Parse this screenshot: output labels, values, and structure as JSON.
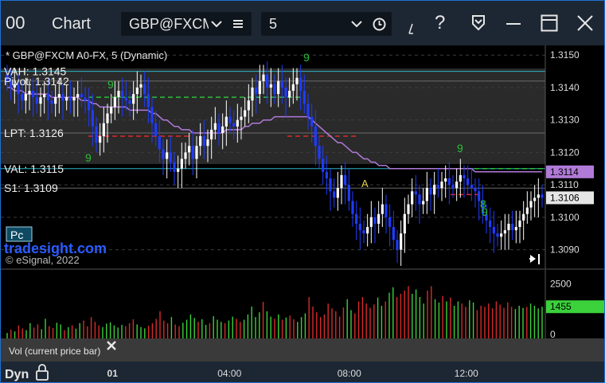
{
  "window": {
    "icon_text": "00",
    "title": "Chart",
    "symbol": "GBP@FXCM",
    "interval": "5",
    "help_glyph": "?",
    "accent_color": "#1f6fd1"
  },
  "chart_data": {
    "type": "candlestick",
    "title": "* GBP@FXCM A0-FX, 5 (Dynamic)",
    "watermark": "tradesight.com",
    "copyright": "© eSignal, 2022",
    "ylim": [
      1.3084,
      1.3153
    ],
    "y_ticks": [
      "1.3150",
      "1.3140",
      "1.3130",
      "1.3120",
      "1.3110",
      "1.3100",
      "1.3090"
    ],
    "x_ticks": [
      "01",
      "04:00",
      "08:00",
      "12:00"
    ],
    "last_price": "1.3106",
    "ma_value": "1.3114",
    "levels": [
      {
        "label": "VAH: 1.3145",
        "value": 1.3145,
        "color": "#2ab6c9"
      },
      {
        "label": "Pivot: 1.3142",
        "value": 1.3142,
        "color": "#6b6b6b"
      },
      {
        "label": "LPT: 1.3126",
        "value": 1.3126,
        "color": "#6b6b6b"
      },
      {
        "label": "VAL: 1.3115",
        "value": 1.3115,
        "color": "#2ab6c9"
      },
      {
        "label": "S1: 1.3109",
        "value": 1.3109,
        "color": "#6b6b6b"
      }
    ],
    "annotation_A": "A",
    "pc_label": "Pc",
    "candle_color_up": "#ffffff",
    "candle_color_down": "#1f3cff",
    "ma_color": "#b07ad9",
    "closes": [
      1.3142,
      1.314,
      1.3141,
      1.3138,
      1.3136,
      1.3138,
      1.3139,
      1.3137,
      1.3135,
      1.3137,
      1.3138,
      1.3136,
      1.3135,
      1.3137,
      1.3138,
      1.3136,
      1.3137,
      1.3136,
      1.3137,
      1.3138,
      1.3137,
      1.3136,
      1.3133,
      1.3128,
      1.3123,
      1.3125,
      1.3129,
      1.3132,
      1.3134,
      1.3137,
      1.3139,
      1.3137,
      1.3136,
      1.3135,
      1.3138,
      1.314,
      1.3141,
      1.3138,
      1.3134,
      1.3129,
      1.3125,
      1.3121,
      1.3118,
      1.312,
      1.3117,
      1.3114,
      1.3115,
      1.3118,
      1.312,
      1.3122,
      1.3118,
      1.3122,
      1.3125,
      1.3122,
      1.3124,
      1.3127,
      1.3129,
      1.3126,
      1.3128,
      1.3131,
      1.3129,
      1.3128,
      1.313,
      1.3131,
      1.3133,
      1.3136,
      1.314,
      1.3138,
      1.3142,
      1.3144,
      1.314,
      1.3141,
      1.3138,
      1.3142,
      1.314,
      1.3137,
      1.3139,
      1.3141,
      1.3143,
      1.3139,
      1.3135,
      1.3131,
      1.3128,
      1.3122,
      1.3118,
      1.3114,
      1.3112,
      1.3108,
      1.3106,
      1.3109,
      1.3113,
      1.311,
      1.3105,
      1.3101,
      1.3098,
      1.3096,
      1.3095,
      1.3097,
      1.31,
      1.3098,
      1.3101,
      1.3104,
      1.31,
      1.3097,
      1.3093,
      1.309,
      1.3095,
      1.3101,
      1.3104,
      1.3108,
      1.3107,
      1.3104,
      1.3105,
      1.3109,
      1.3107,
      1.311,
      1.3109,
      1.3111,
      1.3112,
      1.311,
      1.3109,
      1.3111,
      1.3113,
      1.3112,
      1.311,
      1.3109,
      1.3108,
      1.3105,
      1.3101,
      1.3099,
      1.3097,
      1.3095,
      1.3094,
      1.3095,
      1.3096,
      1.3098,
      1.3096,
      1.3097,
      1.3099,
      1.3101,
      1.3103,
      1.3105,
      1.3106,
      1.3107,
      1.3106
    ],
    "ma": [
      1.314,
      1.314,
      1.3139,
      1.3139,
      1.3139,
      1.3138,
      1.3138,
      1.3138,
      1.3138,
      1.3138,
      1.3138,
      1.3138,
      1.3137,
      1.3137,
      1.3137,
      1.3137,
      1.3137,
      1.3137,
      1.3137,
      1.3137,
      1.3136,
      1.3136,
      1.3136,
      1.3135,
      1.3135,
      1.3134,
      1.3134,
      1.3134,
      1.3134,
      1.3134,
      1.3134,
      1.3134,
      1.3134,
      1.3133,
      1.3133,
      1.3133,
      1.3133,
      1.3133,
      1.3133,
      1.3132,
      1.3132,
      1.3131,
      1.313,
      1.313,
      1.3129,
      1.3128,
      1.3128,
      1.3127,
      1.3127,
      1.3127,
      1.3126,
      1.3126,
      1.3126,
      1.3126,
      1.3126,
      1.3126,
      1.3126,
      1.3126,
      1.3126,
      1.3127,
      1.3127,
      1.3127,
      1.3127,
      1.3127,
      1.3128,
      1.3128,
      1.3129,
      1.3129,
      1.3129,
      1.313,
      1.313,
      1.313,
      1.3131,
      1.3131,
      1.3131,
      1.3131,
      1.3131,
      1.3131,
      1.3131,
      1.3131,
      1.3131,
      1.3131,
      1.313,
      1.3129,
      1.3128,
      1.3127,
      1.3126,
      1.3125,
      1.3124,
      1.3123,
      1.3123,
      1.3122,
      1.3121,
      1.312,
      1.312,
      1.3119,
      1.3118,
      1.3118,
      1.3117,
      1.3117,
      1.3116,
      1.3116,
      1.3116,
      1.3115,
      1.3115,
      1.3115,
      1.3115,
      1.3115,
      1.3115,
      1.3115,
      1.3115,
      1.3115,
      1.3115,
      1.3115,
      1.3115,
      1.3115,
      1.3115,
      1.3115,
      1.3115,
      1.3115,
      1.3115,
      1.3115,
      1.3115,
      1.3115,
      1.3115,
      1.3115,
      1.3114,
      1.3114,
      1.3114,
      1.3114,
      1.3114,
      1.3114,
      1.3114,
      1.3114,
      1.3114,
      1.3114,
      1.3114,
      1.3114,
      1.3114,
      1.3114,
      1.3114,
      1.3114,
      1.3114,
      1.3114,
      1.3114
    ],
    "volume": {
      "label": "Vol (current price bar)",
      "ylim": [
        0,
        3000
      ],
      "ticks": [
        "2500",
        "0"
      ],
      "current": "1455",
      "values": [
        250,
        400,
        320,
        600,
        450,
        380,
        700,
        500,
        650,
        420,
        900,
        560,
        480,
        720,
        640,
        380,
        520,
        600,
        450,
        700,
        820,
        560,
        980,
        760,
        600,
        520,
        680,
        740,
        600,
        500,
        620,
        560,
        700,
        880,
        640,
        520,
        460,
        580,
        700,
        900,
        1250,
        820,
        700,
        980,
        640,
        560,
        720,
        860,
        1100,
        940,
        760,
        880,
        620,
        700,
        1020,
        860,
        760,
        700,
        820,
        1000,
        900,
        760,
        860,
        1100,
        1460,
        980,
        1200,
        1680,
        1250,
        1000,
        900,
        1100,
        860,
        960,
        1050,
        880,
        760,
        980,
        1150,
        1900,
        1460,
        1200,
        980,
        1100,
        1600,
        1380,
        1250,
        1000,
        1420,
        1800,
        1300,
        1150,
        1700,
        1900,
        1600,
        1400,
        1560,
        1880,
        1500,
        1700,
        2100,
        2350,
        1900,
        2050,
        2200,
        2400,
        2050,
        2250,
        1900,
        1600,
        2200,
        2400,
        1800,
        1650,
        1950,
        1700,
        1880,
        1500,
        1700,
        1600,
        1450,
        1750,
        1650,
        1300,
        1500,
        1450,
        1600,
        1380,
        1700,
        1550,
        1400,
        1650,
        1450,
        1350,
        1500,
        1400,
        1450,
        1600,
        1500,
        1380,
        1455
      ]
    },
    "xlabel": "",
    "ylabel": ""
  },
  "footer": {
    "mode": "Dyn"
  }
}
